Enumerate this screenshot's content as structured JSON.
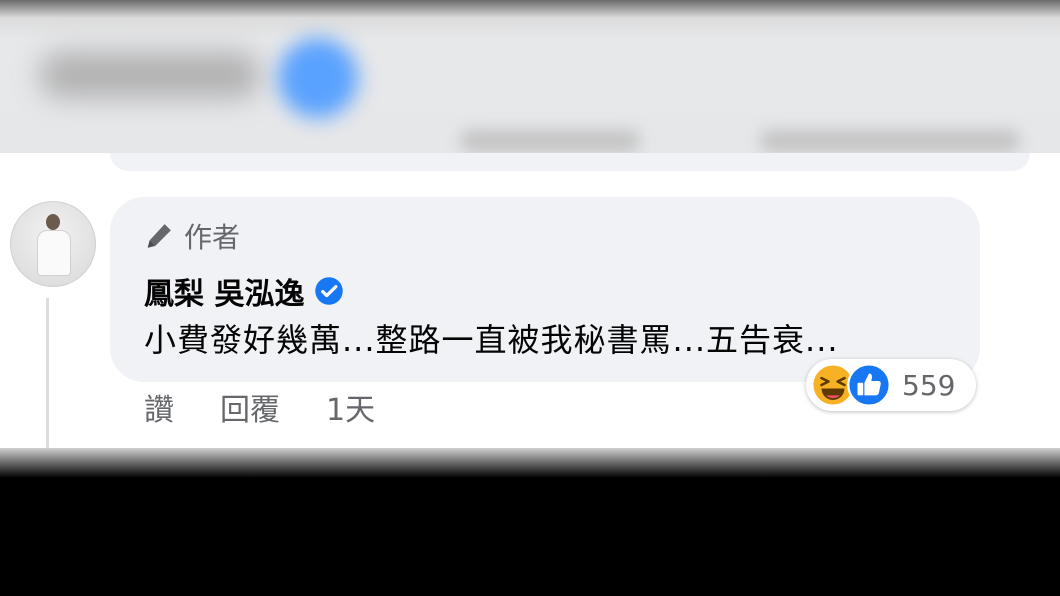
{
  "comment": {
    "author_label": "作者",
    "name": "鳳梨 吳泓逸",
    "text": "小費發好幾萬...整路一直被我秘書罵...五告衰...",
    "actions": {
      "like": "讚",
      "reply": "回覆",
      "time": "1天"
    },
    "reactions": {
      "icons": [
        "haha-icon",
        "like-icon"
      ],
      "count": "559"
    }
  },
  "colors": {
    "bubble": "#f0f2f5",
    "secondary_text": "#65676b",
    "primary_text": "#050505",
    "verified_blue": "#1877f2"
  }
}
